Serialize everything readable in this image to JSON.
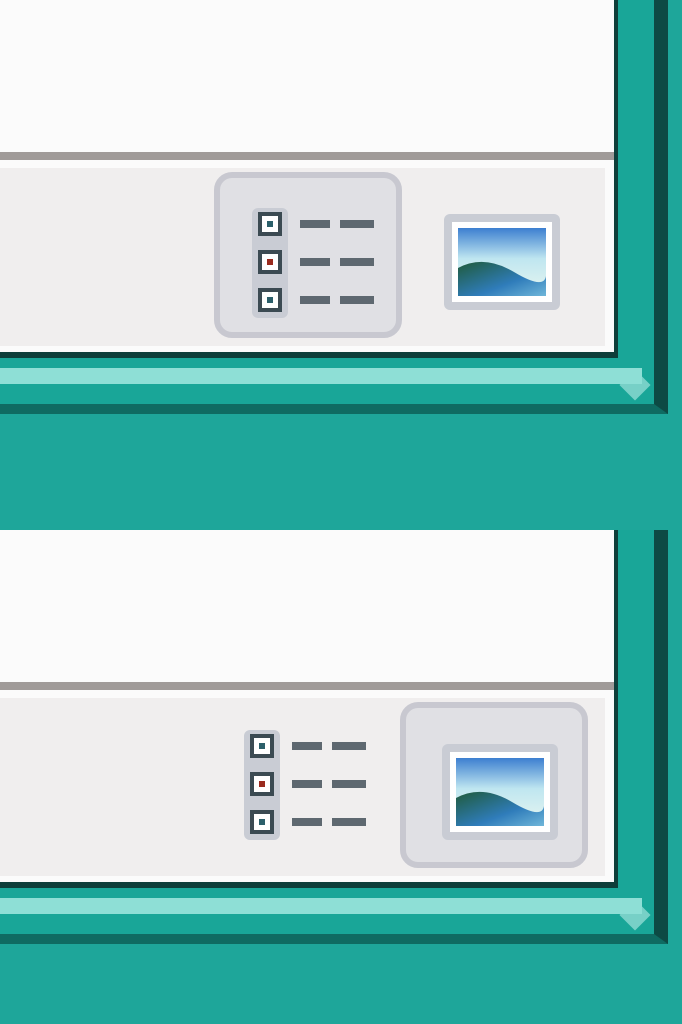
{
  "panels": [
    {
      "id": "top",
      "active_view": "list",
      "buttons": [
        {
          "name": "list-view",
          "icon": "details-list-icon",
          "pressed": true
        },
        {
          "name": "thumbnail-view",
          "icon": "picture-icon",
          "pressed": false
        }
      ]
    },
    {
      "id": "bottom",
      "active_view": "thumbnail",
      "buttons": [
        {
          "name": "list-view",
          "icon": "details-list-icon",
          "pressed": false
        },
        {
          "name": "thumbnail-view",
          "icon": "picture-icon",
          "pressed": true
        }
      ]
    }
  ],
  "colors": {
    "frame_teal": "#19a698",
    "frame_dark": "#0e3e3a",
    "status_bar": "#f0eeee",
    "separator": "#a09b99",
    "list_dot_red": "#9a2a1e",
    "list_dot_teal": "#2b5f6a"
  }
}
